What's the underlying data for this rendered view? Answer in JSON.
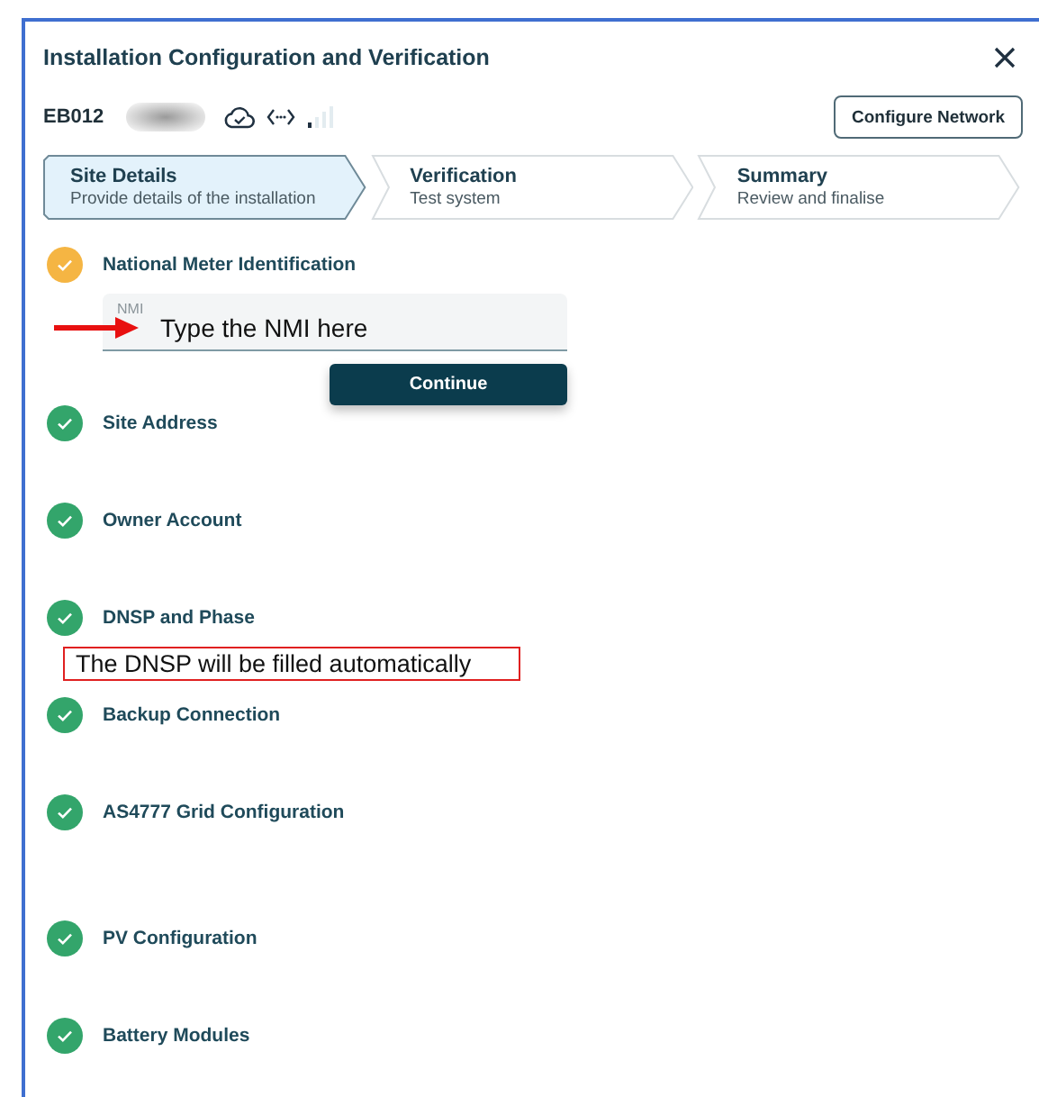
{
  "dialog": {
    "title": "Installation Configuration and Verification"
  },
  "device": {
    "id": "EB012",
    "configure_button": "Configure Network"
  },
  "steps": [
    {
      "label": "Site Details",
      "subtitle": "Provide details of the installation",
      "selected": true
    },
    {
      "label": "Verification",
      "subtitle": "Test system",
      "selected": false
    },
    {
      "label": "Summary",
      "subtitle": "Review and finalise",
      "selected": false
    }
  ],
  "sections": [
    {
      "title": "National Meter Identification",
      "completed": false,
      "field": {
        "label": "NMI",
        "annotation": "Type the NMI here"
      },
      "button": "Continue"
    },
    {
      "title": "Site Address",
      "completed": true
    },
    {
      "title": "Owner Account",
      "completed": true
    },
    {
      "title": "DNSP and Phase",
      "completed": true,
      "annotation": "The DNSP will be filled automatically"
    },
    {
      "title": "Backup Connection",
      "completed": true
    },
    {
      "title": "AS4777 Grid Configuration",
      "completed": true
    },
    {
      "title": "PV Configuration",
      "completed": true
    },
    {
      "title": "Battery Modules",
      "completed": true
    }
  ]
}
